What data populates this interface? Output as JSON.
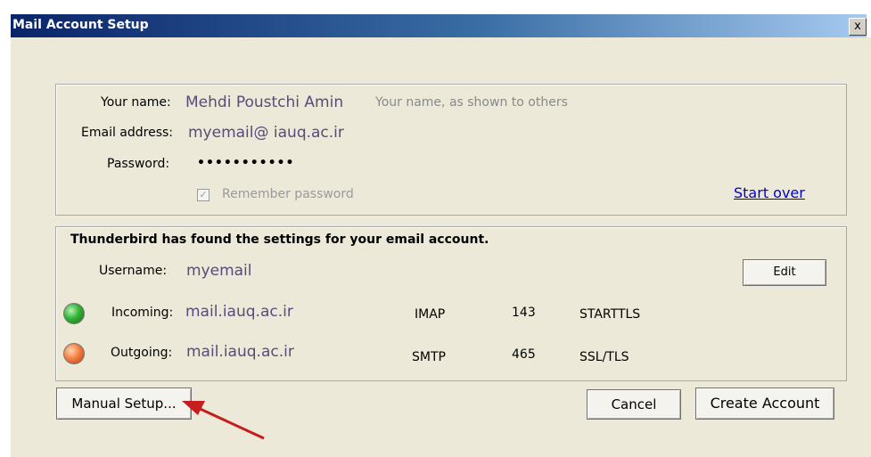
{
  "window": {
    "title": "Mail Account Setup",
    "close_label": "x"
  },
  "account": {
    "name_label": "Your name:",
    "name_value": "Mehdi Poustchi Amin",
    "name_hint": "Your name, as shown to others",
    "email_label": "Email address:",
    "email_value": "myemail@ iauq.ac.ir",
    "password_label": "Password:",
    "password_value": "•••••••••••",
    "remember_label": "Remember password",
    "remember_checked": true,
    "start_over": "Start over"
  },
  "settings": {
    "found_text": "Thunderbird has found the settings for your email account.",
    "username_label": "Username:",
    "username_value": "myemail",
    "edit_label": "Edit",
    "incoming": {
      "label": "Incoming:",
      "host": "mail.iauq.ac.ir",
      "protocol": "IMAP",
      "port": "143",
      "security": "STARTTLS",
      "status_color": "#34b234"
    },
    "outgoing": {
      "label": "Outgoing:",
      "host": "mail.iauq.ac.ir",
      "protocol": "SMTP",
      "port": "465",
      "security": "SSL/TLS",
      "status_color": "#f07838"
    }
  },
  "buttons": {
    "manual_setup": "Manual Setup...",
    "cancel": "Cancel",
    "create_account": "Create Account"
  },
  "annotation": {
    "arrow_color": "#c41e1e",
    "icon": "red-arrow-icon"
  }
}
